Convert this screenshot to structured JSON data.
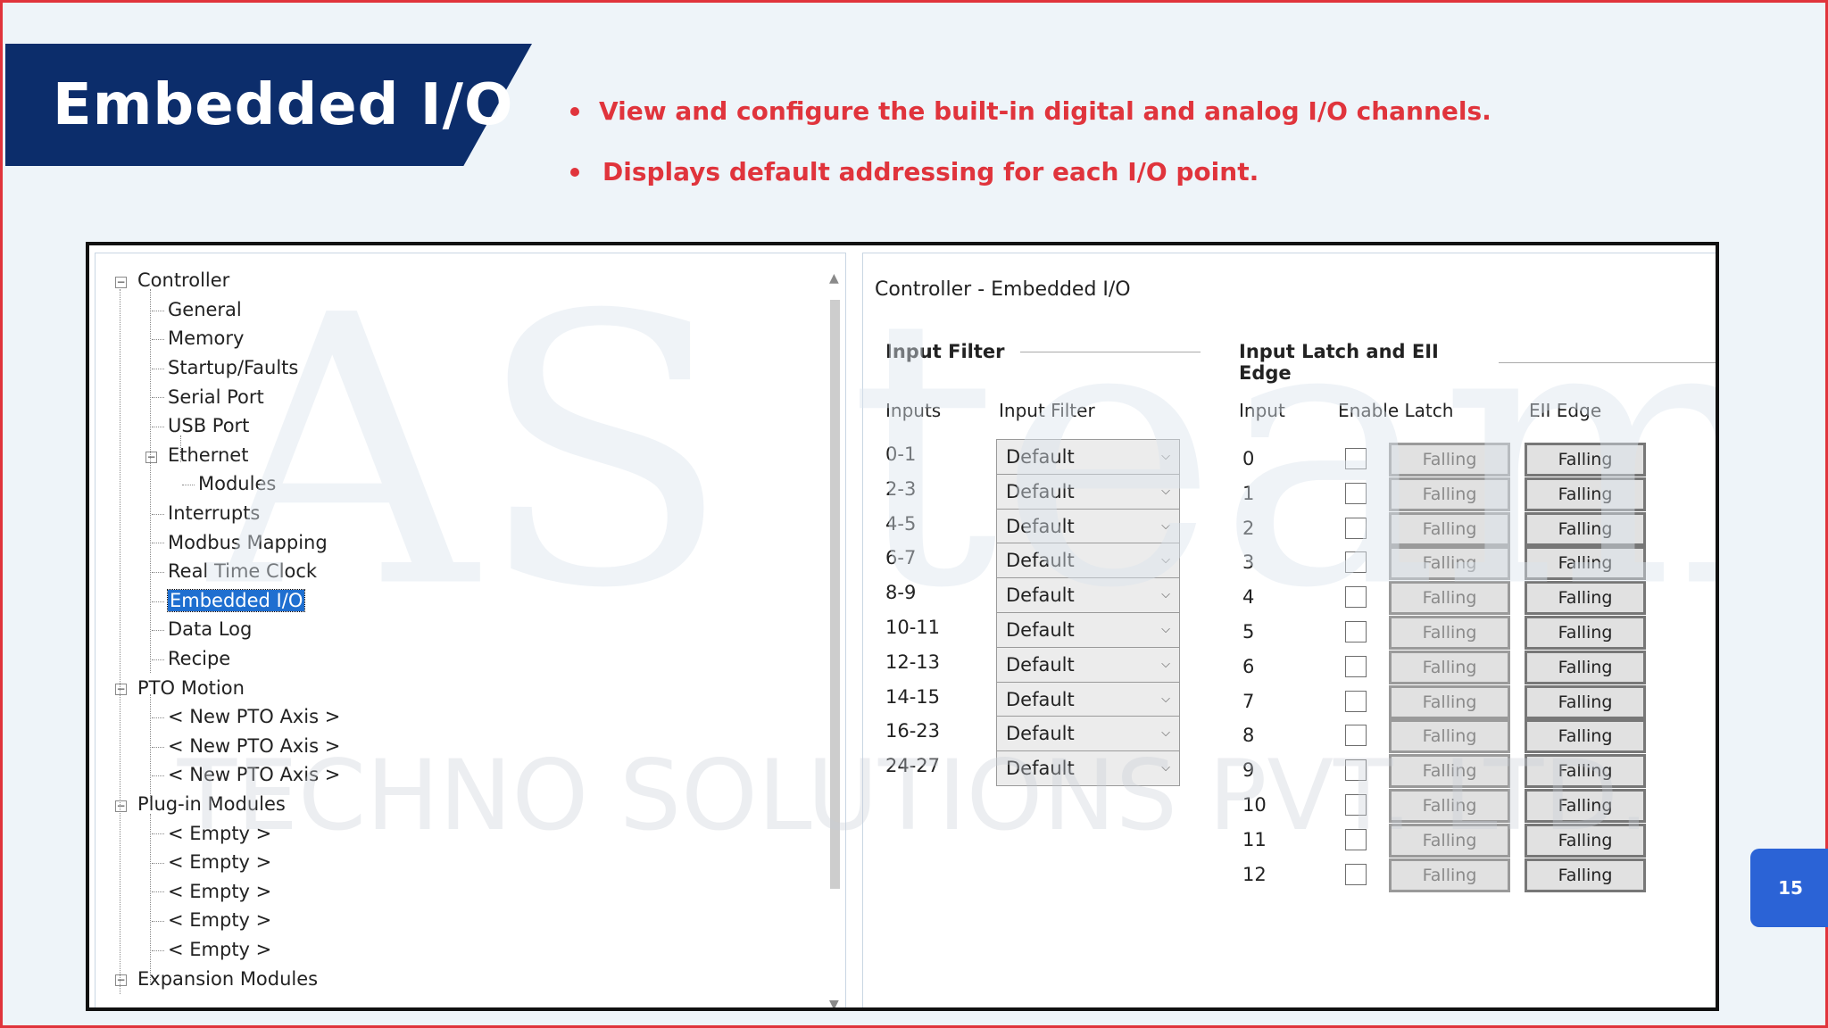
{
  "slide": {
    "title": "Embedded I/O",
    "bullets": [
      "View and configure the built-in digital and analog I/O channels.",
      "Displays default addressing for each I/O point."
    ],
    "page_number": "15"
  },
  "tree": {
    "items": [
      {
        "label": "Controller",
        "level": 0,
        "expander": "−"
      },
      {
        "label": "General",
        "level": 1
      },
      {
        "label": "Memory",
        "level": 1
      },
      {
        "label": "Startup/Faults",
        "level": 1
      },
      {
        "label": "Serial Port",
        "level": 1
      },
      {
        "label": "USB Port",
        "level": 1
      },
      {
        "label": "Ethernet",
        "level": 1,
        "expander": "−"
      },
      {
        "label": "Modules",
        "level": 2
      },
      {
        "label": "Interrupts",
        "level": 1
      },
      {
        "label": "Modbus Mapping",
        "level": 1
      },
      {
        "label": "Real Time Clock",
        "level": 1
      },
      {
        "label": "Embedded I/O",
        "level": 1,
        "selected": true
      },
      {
        "label": "Data Log",
        "level": 1
      },
      {
        "label": "Recipe",
        "level": 1
      },
      {
        "label": "PTO Motion",
        "level": 0,
        "expander": "−"
      },
      {
        "label": "< New PTO Axis >",
        "level": 1
      },
      {
        "label": "< New PTO Axis >",
        "level": 1
      },
      {
        "label": "< New PTO Axis >",
        "level": 1
      },
      {
        "label": "Plug-in Modules",
        "level": 0,
        "expander": "−"
      },
      {
        "label": "< Empty >",
        "level": 1
      },
      {
        "label": "< Empty >",
        "level": 1
      },
      {
        "label": "< Empty >",
        "level": 1
      },
      {
        "label": "< Empty >",
        "level": 1
      },
      {
        "label": "< Empty >",
        "level": 1
      },
      {
        "label": "Expansion Modules",
        "level": 0,
        "expander": "−"
      }
    ]
  },
  "config": {
    "title": "Controller - Embedded I/O",
    "input_filter": {
      "section_title": "Input Filter",
      "col_inputs": "Inputs",
      "col_filter": "Input Filter",
      "rows": [
        {
          "inputs": "0-1",
          "filter": "Default"
        },
        {
          "inputs": "2-3",
          "filter": "Default"
        },
        {
          "inputs": "4-5",
          "filter": "Default"
        },
        {
          "inputs": "6-7",
          "filter": "Default"
        },
        {
          "inputs": "8-9",
          "filter": "Default"
        },
        {
          "inputs": "10-11",
          "filter": "Default"
        },
        {
          "inputs": "12-13",
          "filter": "Default"
        },
        {
          "inputs": "14-15",
          "filter": "Default"
        },
        {
          "inputs": "16-23",
          "filter": "Default"
        },
        {
          "inputs": "24-27",
          "filter": "Default"
        }
      ]
    },
    "latch": {
      "section_title": "Input Latch and EII Edge",
      "col_input": "Input",
      "col_enable": "Enable Latch",
      "col_edge": "EII Edge",
      "rows": [
        {
          "input": "0",
          "latch_edge": "Falling",
          "eii_edge": "Falling"
        },
        {
          "input": "1",
          "latch_edge": "Falling",
          "eii_edge": "Falling"
        },
        {
          "input": "2",
          "latch_edge": "Falling",
          "eii_edge": "Falling"
        },
        {
          "input": "3",
          "latch_edge": "Falling",
          "eii_edge": "Falling"
        },
        {
          "input": "4",
          "latch_edge": "Falling",
          "eii_edge": "Falling"
        },
        {
          "input": "5",
          "latch_edge": "Falling",
          "eii_edge": "Falling"
        },
        {
          "input": "6",
          "latch_edge": "Falling",
          "eii_edge": "Falling"
        },
        {
          "input": "7",
          "latch_edge": "Falling",
          "eii_edge": "Falling"
        },
        {
          "input": "8",
          "latch_edge": "Falling",
          "eii_edge": "Falling"
        },
        {
          "input": "9",
          "latch_edge": "Falling",
          "eii_edge": "Falling"
        },
        {
          "input": "10",
          "latch_edge": "Falling",
          "eii_edge": "Falling"
        },
        {
          "input": "11",
          "latch_edge": "Falling",
          "eii_edge": "Falling"
        },
        {
          "input": "12",
          "latch_edge": "Falling",
          "eii_edge": "Falling"
        }
      ]
    }
  },
  "watermark": {
    "line1": "AS team",
    "line2": "TECHNO SOLUTIONS PVT. LTD."
  },
  "colors": {
    "accent_red": "#e0343c",
    "banner_navy": "#0c2d6b",
    "selection_blue": "#1f6fd0",
    "page_badge": "#2b63d6"
  }
}
